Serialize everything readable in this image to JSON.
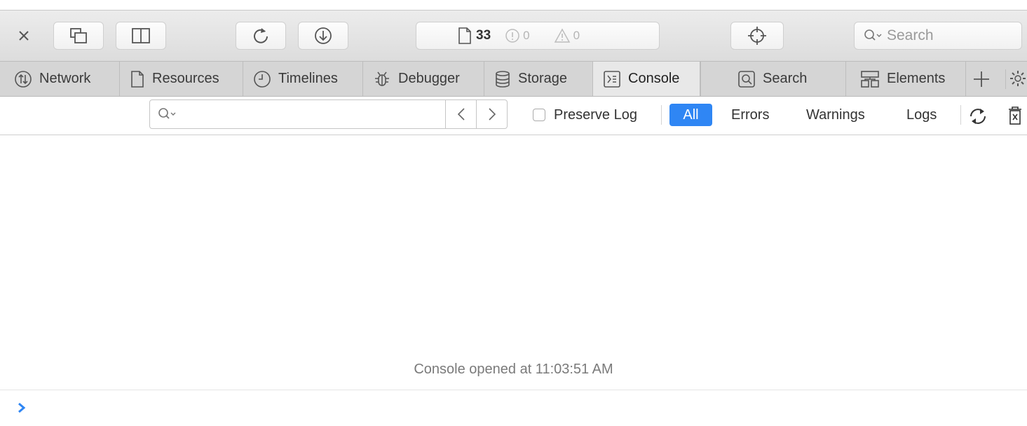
{
  "toolbar": {
    "resource_count": "33",
    "error_count": "0",
    "warning_count": "0",
    "search_placeholder": "Search",
    "buttons": [
      "close-icon",
      "undock-icon",
      "dock-side-icon",
      "reload-icon",
      "download-icon",
      "inspect-crosshair-icon"
    ]
  },
  "tabs": [
    {
      "label": "Network",
      "icon": "network-icon"
    },
    {
      "label": "Resources",
      "icon": "document-icon"
    },
    {
      "label": "Timelines",
      "icon": "clock-icon"
    },
    {
      "label": "Debugger",
      "icon": "bug-icon"
    },
    {
      "label": "Storage",
      "icon": "database-icon"
    },
    {
      "label": "Console",
      "icon": "console-icon",
      "active": true
    },
    {
      "label": "Search",
      "icon": "search-icon"
    },
    {
      "label": "Elements",
      "icon": "elements-icon"
    }
  ],
  "filter": {
    "preserve_log_label": "Preserve Log",
    "preserve_log_checked": false,
    "levels": [
      "All",
      "Errors",
      "Warnings",
      "Logs"
    ],
    "selected_level": "All"
  },
  "console": {
    "opened_message": "Console opened at 11:03:51 AM"
  },
  "colors": {
    "accent": "#2f86f4",
    "prompt": "#2f86f4"
  }
}
